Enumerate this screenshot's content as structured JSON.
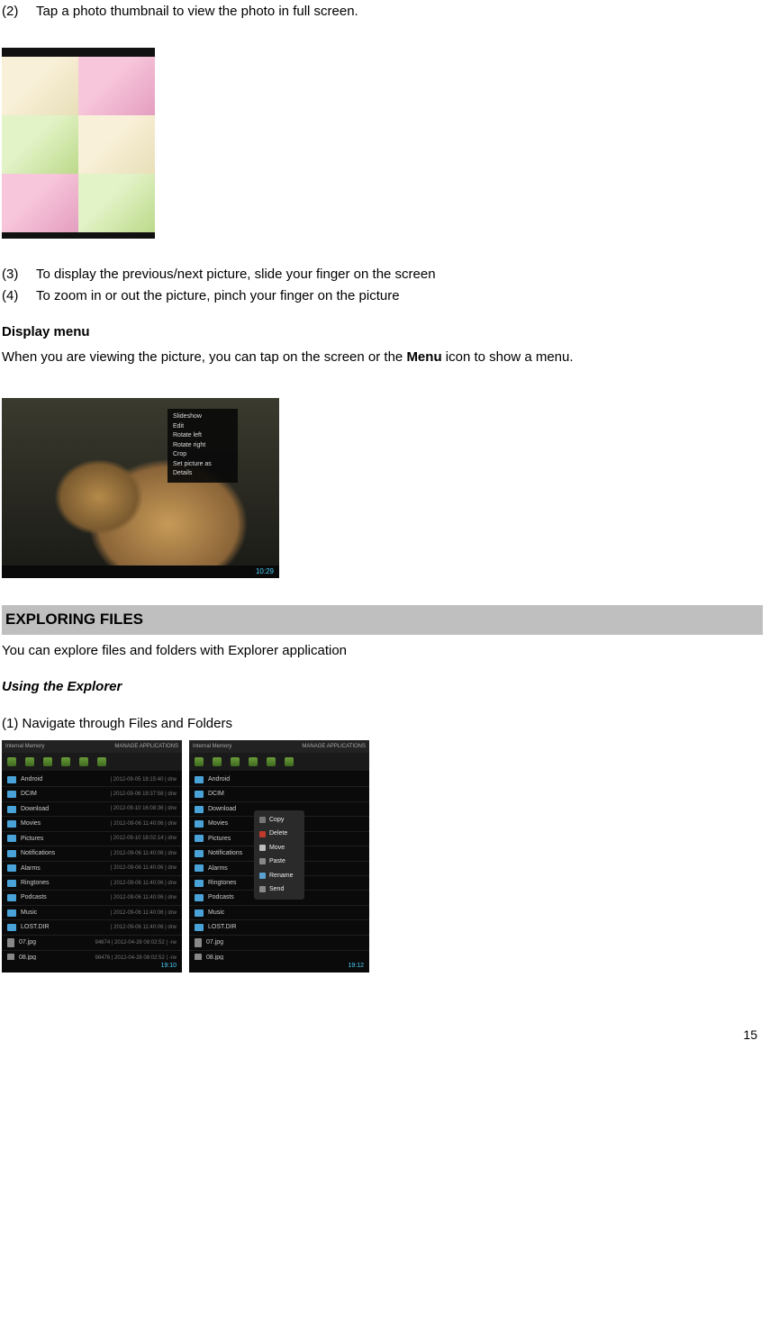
{
  "steps": {
    "s2_num": "(2)",
    "s2_text": "Tap a photo thumbnail to view the photo in full screen.",
    "s3_num": "(3)",
    "s3_text": "To display the previous/next picture, slide your finger on the screen",
    "s4_num": "(4)",
    "s4_text": "To zoom in or out the picture, pinch your finger on the picture"
  },
  "display_menu": {
    "heading": "Display menu",
    "text_pre": "When you are viewing the picture, you can tap on the screen or the ",
    "text_bold": "Menu",
    "text_post": " icon to show a menu."
  },
  "photo_menu_popup": {
    "items": [
      "Slideshow",
      "Edit",
      "Rotate left",
      "Rotate right",
      "Crop",
      "Set picture as",
      "Details"
    ],
    "time": "10:29"
  },
  "exploring": {
    "heading": "EXPLORING FILES",
    "intro": "You can explore files and folders with Explorer application",
    "using_heading": "Using the Explorer",
    "nav_title": "(1) Navigate through Files and Folders"
  },
  "explorer_left": {
    "topbar_left": "Internal Memory",
    "topbar_right": "MANAGE APPLICATIONS",
    "rows": [
      {
        "name": "Android",
        "meta": "| 2012-09-05 18:15:40 | drw",
        "icon": "folder"
      },
      {
        "name": "DCIM",
        "meta": "| 2012-09-06 19:37:58 | drw",
        "icon": "folder"
      },
      {
        "name": "Download",
        "meta": "| 2012-09-10 16:08:36 | drw",
        "icon": "folder"
      },
      {
        "name": "Movies",
        "meta": "| 2012-09-06 11:40:06 | drw",
        "icon": "folder"
      },
      {
        "name": "Pictures",
        "meta": "| 2012-09-10 18:02:14 | drw",
        "icon": "folder"
      },
      {
        "name": "Notifications",
        "meta": "| 2012-09-06 11:40:06 | drw",
        "icon": "folder"
      },
      {
        "name": "Alarms",
        "meta": "| 2012-09-06 11:40:06 | drw",
        "icon": "folder"
      },
      {
        "name": "Ringtones",
        "meta": "| 2012-09-06 11:40:06 | drw",
        "icon": "folder"
      },
      {
        "name": "Podcasts",
        "meta": "| 2012-09-06 11:40:06 | drw",
        "icon": "folder"
      },
      {
        "name": "Music",
        "meta": "| 2012-09-06 11:40:06 | drw",
        "icon": "folder"
      },
      {
        "name": "LOST.DIR",
        "meta": "| 2012-09-06 11:40:06 | drw",
        "icon": "folder"
      },
      {
        "name": "07.jpg",
        "meta": "94674 | 2012-04-28 08:02:52 | -rw",
        "icon": "file"
      },
      {
        "name": "08.jpg",
        "meta": "96476 | 2012-04-28 08:02:52 | -rw",
        "icon": "file"
      }
    ],
    "time": "19:10"
  },
  "explorer_right": {
    "topbar_left": "Internal Memory",
    "topbar_right": "MANAGE APPLICATIONS",
    "rows": [
      {
        "name": "Android",
        "meta": "",
        "icon": "folder"
      },
      {
        "name": "DCIM",
        "meta": "",
        "icon": "folder"
      },
      {
        "name": "Download",
        "meta": "",
        "icon": "folder"
      },
      {
        "name": "Movies",
        "meta": "",
        "icon": "folder"
      },
      {
        "name": "Pictures",
        "meta": "",
        "icon": "folder"
      },
      {
        "name": "Notifications",
        "meta": "",
        "icon": "folder"
      },
      {
        "name": "Alarms",
        "meta": "",
        "icon": "folder"
      },
      {
        "name": "Ringtones",
        "meta": "",
        "icon": "folder"
      },
      {
        "name": "Podcasts",
        "meta": "",
        "icon": "folder"
      },
      {
        "name": "Music",
        "meta": "",
        "icon": "folder"
      },
      {
        "name": "LOST.DIR",
        "meta": "",
        "icon": "folder"
      },
      {
        "name": "07.jpg",
        "meta": "",
        "icon": "file"
      },
      {
        "name": "08.jpg",
        "meta": "",
        "icon": "file"
      }
    ],
    "context_menu": [
      "Copy",
      "Delete",
      "Move",
      "Paste",
      "Rename",
      "Send"
    ],
    "time": "19:12"
  },
  "page_number": "15"
}
